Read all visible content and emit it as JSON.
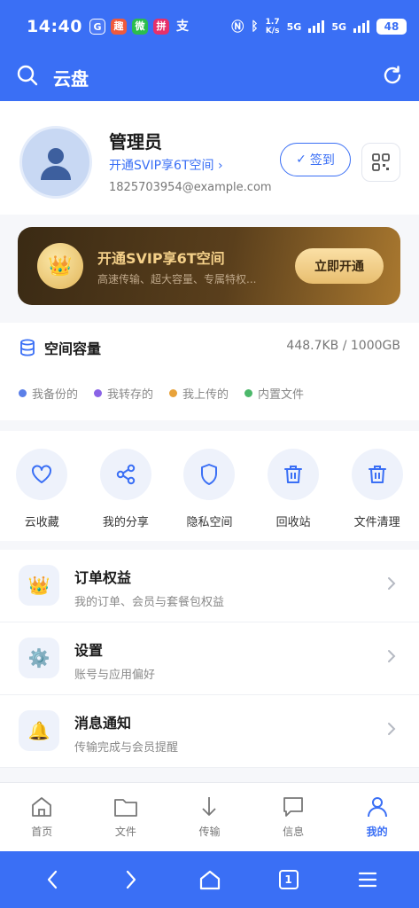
{
  "status_bar": {
    "time": "14:40",
    "app_icons": [
      {
        "name": "app-icon-a",
        "glyph": "G",
        "color": "#4c7af7"
      },
      {
        "name": "app-icon-b",
        "glyph": "趣",
        "color": "#f05a3c"
      },
      {
        "name": "app-icon-wechat",
        "glyph": "微",
        "color": "#2bbd4d"
      },
      {
        "name": "app-icon-c",
        "glyph": "拼",
        "color": "#e6306b"
      },
      {
        "name": "app-icon-alipay",
        "glyph": "支",
        "color": "#3a6ff5"
      }
    ],
    "speed": "1.7",
    "speed_unit": "K/s",
    "net1": "5G",
    "net2": "5G",
    "battery": "48"
  },
  "appbar": {
    "title": "云盘"
  },
  "profile": {
    "name": "管理员",
    "promo": "开通SVIP享6T空间 ›",
    "email": "1825703954@example.com",
    "checkin_label": "签到"
  },
  "vip_banner": {
    "title": "开通SVIP享6T空间",
    "subtitle": "高速传输、超大容量、专属特权...",
    "button": "立即开通"
  },
  "storage": {
    "title": "空间容量",
    "value": "448.7KB / 1000GB",
    "legend": [
      {
        "label": "我备份的",
        "color": "#5b7fe8"
      },
      {
        "label": "我转存的",
        "color": "#8a63e6"
      },
      {
        "label": "我上传的",
        "color": "#e8a23a"
      },
      {
        "label": "内置文件",
        "color": "#4cb86a"
      }
    ]
  },
  "tools": [
    {
      "label": "云收藏"
    },
    {
      "label": "我的分享"
    },
    {
      "label": "隐私空间"
    },
    {
      "label": "回收站"
    },
    {
      "label": "文件清理"
    }
  ],
  "menu": [
    {
      "title": "订单权益",
      "subtitle": "我的订单、会员与套餐包权益",
      "icon": "crown-icon"
    },
    {
      "title": "设置",
      "subtitle": "账号与应用偏好",
      "icon": "gear-icon"
    },
    {
      "title": "消息通知",
      "subtitle": "传输完成与会员提醒",
      "icon": "bell-icon"
    }
  ],
  "bottom_nav": [
    {
      "label": "首页",
      "active": false
    },
    {
      "label": "文件",
      "active": false
    },
    {
      "label": "传输",
      "active": false
    },
    {
      "label": "信息",
      "active": false
    },
    {
      "label": "我的",
      "active": true
    }
  ],
  "system_nav": {
    "tabs_count": "1"
  }
}
